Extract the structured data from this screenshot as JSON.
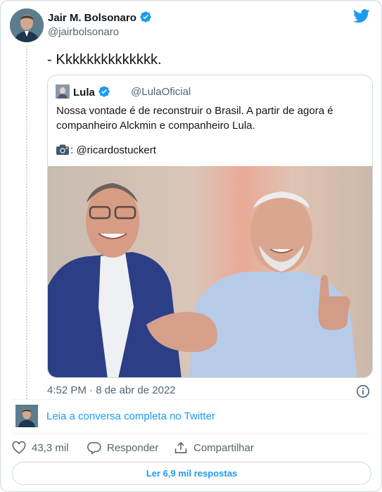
{
  "tweet": {
    "author_name": "Jair M. Bolsonaro",
    "author_handle": "@jairbolsonaro",
    "text": "- Kkkkkkkkkkkkkk.",
    "timestamp": "4:52 PM · 8 de abr de 2022"
  },
  "quoted_tweet": {
    "author_name": "Lula",
    "author_handle": "@LulaOficial",
    "text": "Nossa vontade é de reconstruir o Brasil. A partir de agora é companheiro Alckmin e companheiro Lula.",
    "photo_credit": ": @ricardostuckert"
  },
  "read_conversation_label": "Leia a conversa completa no Twitter",
  "actions": {
    "likes_count": "43,3 mil",
    "reply_label": "Responder",
    "share_label": "Compartilhar"
  },
  "replies_button_label": "Ler 6,9 mil respostas",
  "icons": {
    "brand": "twitter-bird-icon",
    "verified": "verified-badge-icon",
    "info": "info-icon",
    "like": "heart-icon",
    "reply": "reply-icon",
    "share": "share-icon",
    "camera": "camera-icon"
  },
  "colors": {
    "accent": "#1d9bf0",
    "text": "#0f1419",
    "secondary": "#536471",
    "border": "#cfd9de"
  }
}
